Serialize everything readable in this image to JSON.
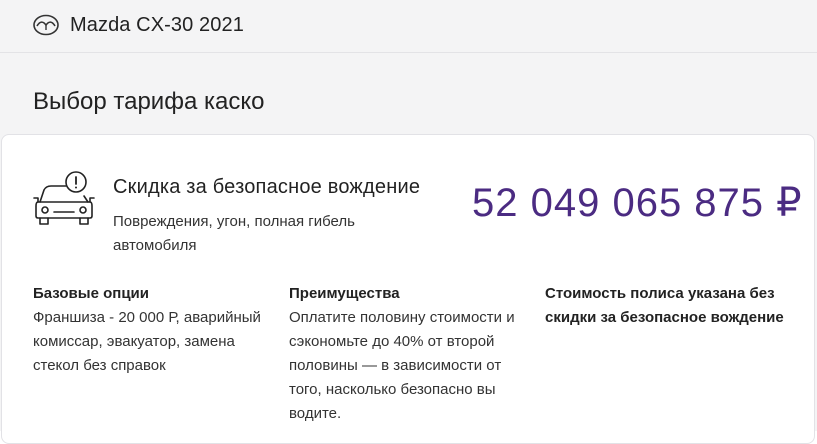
{
  "header": {
    "brand_icon": "mazda-logo-icon",
    "car_title": "Mazda CX-30 2021"
  },
  "page": {
    "section_title": "Выбор тарифа каско"
  },
  "tariff": {
    "icon": "car-shield-icon",
    "name": "Скидка за безопасное вождение",
    "description": "Повреждения, угон, полная гибель автомобиля",
    "price": "52 049 065 875 ₽",
    "price_color": "#4b2b82"
  },
  "details": {
    "base_options": {
      "heading": "Базовые опции",
      "text": "Франшиза - 20 000 Р, аварийный комиссар, эвакуатор, замена стекол без справок"
    },
    "advantages": {
      "heading": "Преимущества",
      "text": "Оплатите половину стоимости и сэкономьте до 40% от второй половины — в зависимости от того, насколько безопасно вы водите."
    },
    "note": "Стоимость полиса указана без скидки за безопасное вождение"
  }
}
